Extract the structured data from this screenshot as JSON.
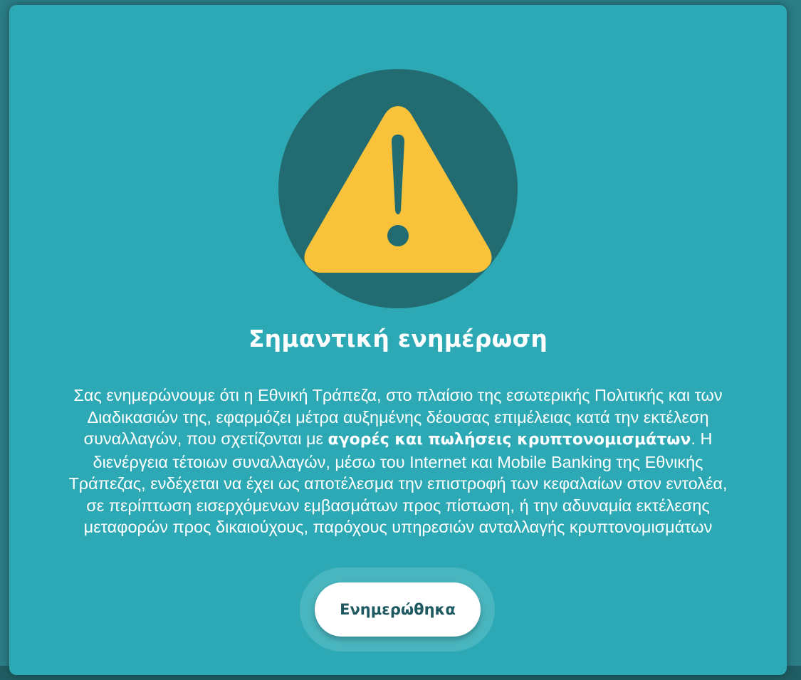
{
  "dialog": {
    "icon": "warning-icon",
    "title": "Σημαντική ενημέρωση",
    "message": {
      "part1": "Σας ενημερώνουμε ότι η Εθνική Τράπεζα, στο πλαίσιο της εσωτερικής Πολιτικής και των Διαδικασιών της, εφαρμόζει μέτρα αυξημένης δέουσας επιμέλειας κατά την εκτέλεση συναλλαγών, που σχετίζονται με ",
      "bold": "αγορές και πωλήσεις κρυπτονομισμάτων",
      "part2": ". Η διενέργεια τέτοιων συναλλαγών, μέσω του Internet και Mobile Banking της Εθνικής Τράπεζας, ενδέχεται να έχει ως αποτέλεσμα την επιστροφή των κεφαλαίων στον εντολέα, σε περίπτωση εισερχόμενων εμβασμάτων προς πίστωση, ή την αδυναμία εκτέλεσης μεταφορών προς δικαιούχους, παρόχους υπηρεσιών ανταλλαγής κρυπτονομισμάτων"
    },
    "confirm_label": "Ενημερώθηκα"
  },
  "colors": {
    "dialog_background": "#2ca9b4",
    "icon_circle": "#216b71",
    "warning_yellow": "#f8c23a",
    "button_text": "#1f5961"
  }
}
